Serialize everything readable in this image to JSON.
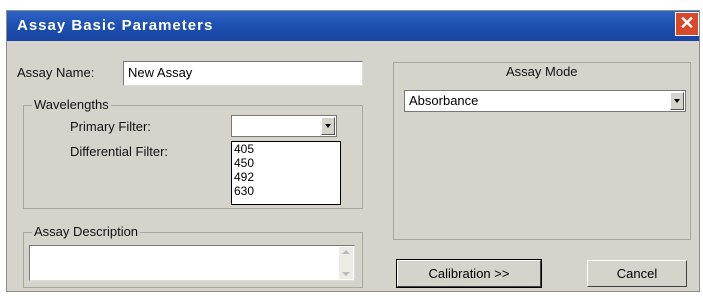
{
  "window": {
    "title": "Assay Basic Parameters",
    "close_symbol": "✕"
  },
  "assay_name": {
    "label": "Assay Name:",
    "value": "New Assay"
  },
  "wavelengths": {
    "legend": "Wavelengths",
    "primary_label": "Primary Filter:",
    "primary_value": "",
    "differential_label": "Differential Filter:",
    "options": [
      "405",
      "450",
      "492",
      "630"
    ]
  },
  "description": {
    "legend": "Assay Description",
    "value": ""
  },
  "assay_mode": {
    "legend": "Assay Mode",
    "value": "Absorbance"
  },
  "buttons": {
    "calibration": "Calibration  >>",
    "cancel": "Cancel"
  }
}
